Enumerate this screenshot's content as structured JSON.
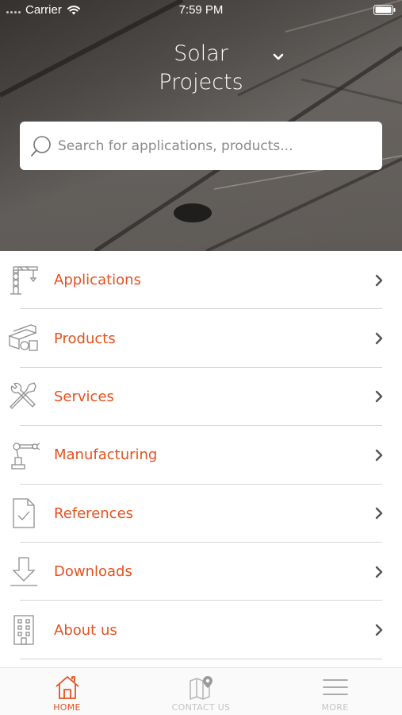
{
  "status_bar": {
    "carrier": "Carrier",
    "time": "7:59 PM"
  },
  "header": {
    "title_line1": "Solar",
    "title_line2": "Projects"
  },
  "search": {
    "placeholder": "Search for applications, products..."
  },
  "menu": {
    "items": [
      {
        "label": "Applications",
        "icon": "crane-icon"
      },
      {
        "label": "Products",
        "icon": "products-icon"
      },
      {
        "label": "Services",
        "icon": "tools-icon"
      },
      {
        "label": "Manufacturing",
        "icon": "robot-arm-icon"
      },
      {
        "label": "References",
        "icon": "document-check-icon"
      },
      {
        "label": "Downloads",
        "icon": "download-icon"
      },
      {
        "label": "About us",
        "icon": "building-icon"
      }
    ]
  },
  "tabbar": {
    "home": "HOME",
    "contact": "CONTACT US",
    "more": "MORE"
  },
  "colors": {
    "accent": "#e8501f",
    "inactive": "#c4c4c4",
    "divider": "#d6d6d6"
  }
}
